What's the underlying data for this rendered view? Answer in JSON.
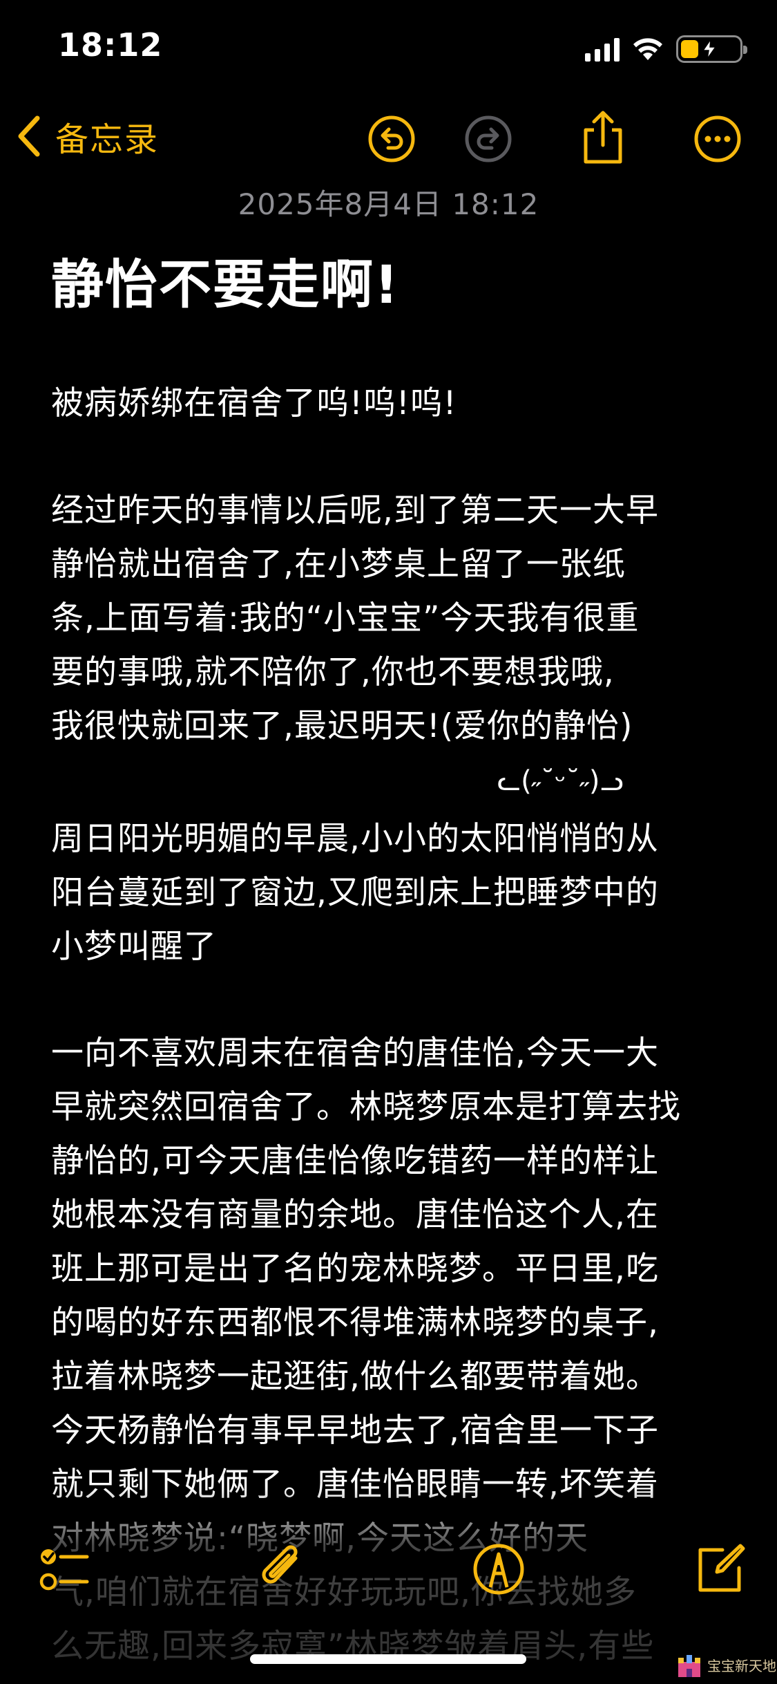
{
  "status_bar": {
    "time": "18:12"
  },
  "nav": {
    "back_label": "备忘录"
  },
  "note": {
    "date": "2025年8月4日 18:12",
    "title": "静怡不要走啊!",
    "paragraphs": [
      {
        "lines": [
          "被病娇绑在宿舍了呜!呜!呜!"
        ]
      },
      {
        "lines": [
          "经过昨天的事情以后呢,到了第二天一大早",
          "静怡就出宿舍了,在小梦桌上留了一张纸",
          "条,上面写着:我的“小宝宝”今天我有很重",
          "要的事哦,就不陪你了,你也不要想我哦,",
          "我很快就回来了,最迟明天!(爱你的静怡)"
        ]
      },
      {
        "lines": [
          "周日阳光明媚的早晨,小小的太阳悄悄的从",
          "阳台蔓延到了窗边,又爬到床上把睡梦中的",
          "小梦叫醒了"
        ]
      },
      {
        "lines": [
          "一向不喜欢周末在宿舍的唐佳怡,今天一大",
          "早就突然回宿舍了。林晓梦原本是打算去找",
          "静怡的,可今天唐佳怡像吃错药一样的样让",
          "她根本没有商量的余地。唐佳怡这个人,在",
          "班上那可是出了名的宠林晓梦。平日里,吃",
          "的喝的好东西都恨不得堆满林晓梦的桌子,",
          "拉着林晓梦一起逛街,做什么都要带着她。",
          "今天杨静怡有事早早地去了,宿舍里一下子",
          "就只剩下她俩了。唐佳怡眼睛一转,坏笑着",
          "对林晓梦说:“晓梦啊,今天这么好的天",
          "气,咱们就在宿舍好好玩玩吧,你去找她多",
          "么无趣,回来多寂寞”林晓梦皱着眉头,有些"
        ]
      }
    ],
    "kaomoji": "ᓚ(˶˘ᵕ˘˶)ᓗ"
  },
  "watermark": {
    "text": "宝宝新天地"
  },
  "colors": {
    "accent": "#f6b80f",
    "disabled": "#5a5a5e",
    "date_gray": "#8e8e93",
    "background": "#000000"
  },
  "icons": {
    "back": "chevron-left-icon",
    "undo": "undo-icon",
    "redo": "redo-icon",
    "share": "share-icon",
    "more": "more-icon",
    "checklist": "checklist-icon",
    "attach": "paperclip-icon",
    "markup": "markup-pen-icon",
    "compose": "compose-icon"
  }
}
